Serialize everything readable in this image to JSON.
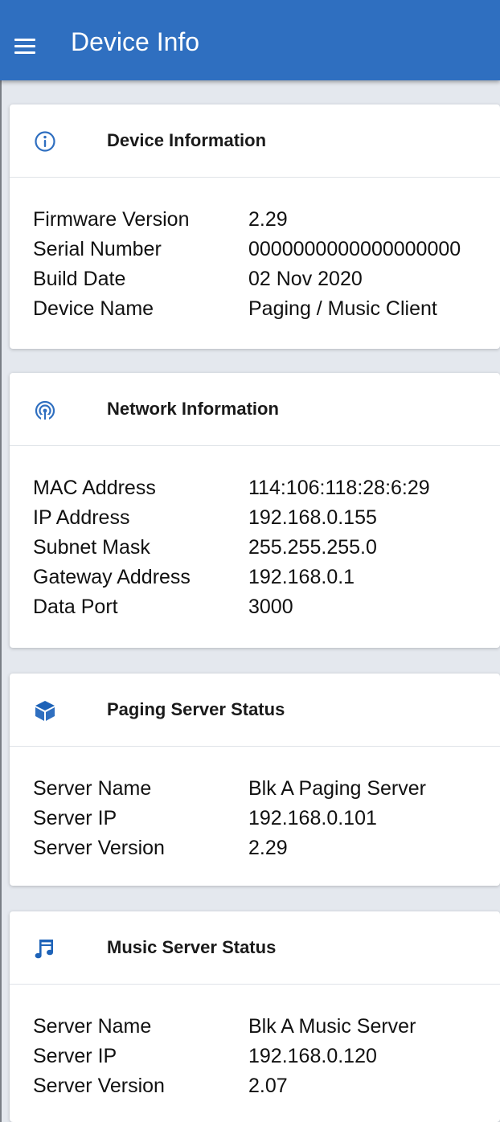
{
  "app_bar": {
    "title": "Device Info",
    "menu_icon": "menu-icon",
    "color": "#2f6fc0"
  },
  "cards": [
    {
      "title": "Device Information",
      "icon": "info-icon",
      "rows": [
        {
          "label": "Firmware Version",
          "value": "2.29"
        },
        {
          "label": "Serial Number",
          "value": "0000000000000000000"
        },
        {
          "label": "Build Date",
          "value": "02 Nov 2020"
        },
        {
          "label": "Device Name",
          "value": "Paging / Music Client"
        }
      ]
    },
    {
      "title": "Network Information",
      "icon": "wireless-signal-icon",
      "rows": [
        {
          "label": "MAC Address",
          "value": "114:106:118:28:6:29"
        },
        {
          "label": "IP Address",
          "value": "192.168.0.155"
        },
        {
          "label": "Subnet Mask",
          "value": "255.255.255.0"
        },
        {
          "label": "Gateway Address",
          "value": "192.168.0.1"
        },
        {
          "label": "Data Port",
          "value": "3000"
        }
      ]
    },
    {
      "title": "Paging Server Status",
      "icon": "cube-icon",
      "rows": [
        {
          "label": "Server Name",
          "value": "Blk A Paging Server"
        },
        {
          "label": "Server IP",
          "value": "192.168.0.101"
        },
        {
          "label": "Server Version",
          "value": "2.29"
        }
      ]
    },
    {
      "title": "Music Server Status",
      "icon": "music-note-icon",
      "rows": [
        {
          "label": "Server Name",
          "value": "Blk A Music Server"
        },
        {
          "label": "Server IP",
          "value": "192.168.0.120"
        },
        {
          "label": "Server Version",
          "value": "2.07"
        }
      ]
    }
  ]
}
